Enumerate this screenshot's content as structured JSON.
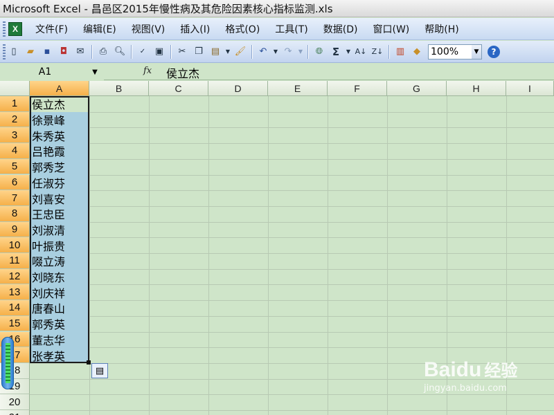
{
  "window": {
    "title": "Microsoft Excel - 昌邑区2015年慢性病及其危险因素核心指标监测.xls"
  },
  "menu": {
    "items": [
      "文件(F)",
      "编辑(E)",
      "视图(V)",
      "插入(I)",
      "格式(O)",
      "工具(T)",
      "数据(D)",
      "窗口(W)",
      "帮助(H)"
    ]
  },
  "toolbar": {
    "zoom": "100%",
    "icons": [
      "new-icon",
      "open-icon",
      "save-icon",
      "permission-icon",
      "email-icon",
      "print-icon",
      "print-preview-icon",
      "spelling-icon",
      "research-icon",
      "cut-icon",
      "copy-icon",
      "paste-icon",
      "format-painter-icon",
      "undo-icon",
      "redo-icon",
      "hyperlink-icon",
      "autosum-icon",
      "sort-ascending-icon",
      "sort-descending-icon",
      "chart-wizard-icon",
      "drawing-icon",
      "help-icon"
    ]
  },
  "formula_bar": {
    "name_box": "A1",
    "fx": "fx",
    "value": "侯立杰"
  },
  "sheet": {
    "columns": [
      "A",
      "B",
      "C",
      "D",
      "E",
      "F",
      "G",
      "H",
      "I"
    ],
    "rows": [
      "1",
      "2",
      "3",
      "4",
      "5",
      "6",
      "7",
      "8",
      "9",
      "10",
      "11",
      "12",
      "13",
      "14",
      "15",
      "16",
      "17",
      "18",
      "19",
      "20",
      "21"
    ],
    "column_a_values": [
      "侯立杰",
      "徐景峰",
      "朱秀英",
      "吕艳霞",
      "郭秀芝",
      "任淑芬",
      "刘喜安",
      "王忠臣",
      "刘淑清",
      "叶振贵",
      "啜立涛",
      "刘晓东",
      "刘庆祥",
      "唐春山",
      "郭秀英",
      "董志华",
      "张孝英"
    ],
    "selected_range": "A1:A17"
  },
  "watermark": {
    "logo": "Baidu",
    "cn": "经验",
    "url": "jingyan.baidu.com"
  }
}
